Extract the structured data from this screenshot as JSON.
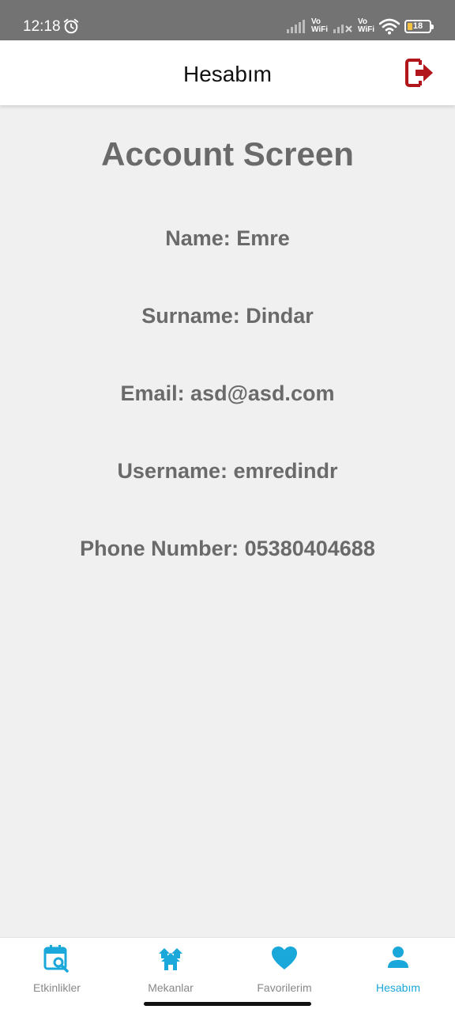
{
  "status_bar": {
    "time": "12:18",
    "battery": "18",
    "vowifi_top": "Vo",
    "vowifi_bottom": "WiFi",
    "icons": [
      "alarm-icon",
      "signal-icon",
      "wifi-icon",
      "battery-icon"
    ]
  },
  "app_bar": {
    "title": "Hesabım",
    "logout_icon": "logout-icon",
    "logout_color": "#b0161b"
  },
  "account": {
    "heading": "Account Screen",
    "name": "Name: Emre",
    "surname": "Surname: Dindar",
    "email": "Email: asd@asd.com",
    "username": "Username: emredindr",
    "phone": "Phone Number: 05380404688"
  },
  "bottom_nav": {
    "accent_color": "#1aa7d9",
    "items": [
      {
        "label": "Etkinlikler",
        "icon": "calendar-search-icon",
        "active": false
      },
      {
        "label": "Mekanlar",
        "icon": "houses-icon",
        "active": false
      },
      {
        "label": "Favorilerim",
        "icon": "heart-icon",
        "active": false
      },
      {
        "label": "Hesabım",
        "icon": "person-icon",
        "active": true
      }
    ]
  }
}
